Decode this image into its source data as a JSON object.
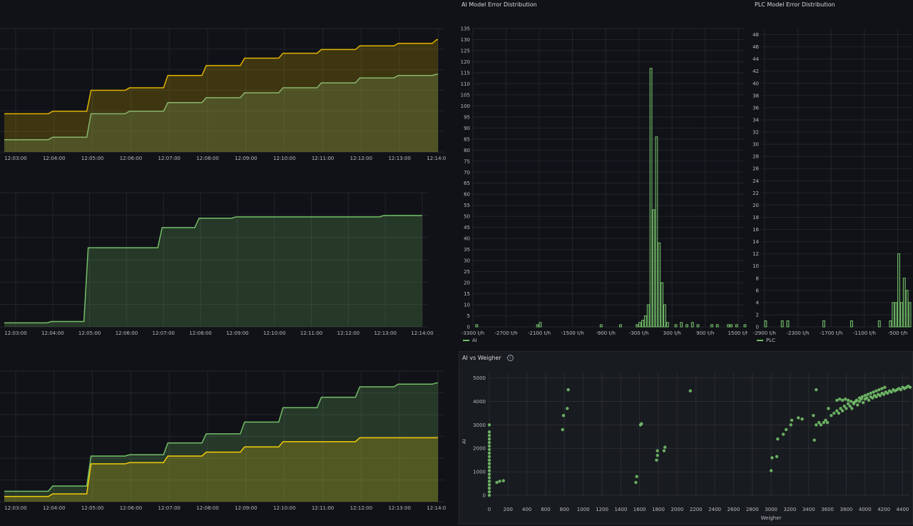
{
  "panels": {
    "left_top": {
      "time_ticks": [
        "12:03:00",
        "12:04:00",
        "12:05:00",
        "12:06:00",
        "12:07:00",
        "12:08:00",
        "12:09:00",
        "12:10:00",
        "12:11:00",
        "12:12:00",
        "12:13:00",
        "12:14:00"
      ],
      "series_colors": [
        "#e0b400",
        "#8ab66b"
      ]
    },
    "left_mid": {
      "time_ticks": [
        "12:03:00",
        "12:04:00",
        "12:05:00",
        "12:06:00",
        "12:07:00",
        "12:08:00",
        "12:09:00",
        "12:10:00",
        "12:11:00",
        "12:12:00",
        "12:13:00",
        "12:14:00"
      ],
      "series_colors": [
        "#73bf69"
      ]
    },
    "left_bottom": {
      "time_ticks": [
        "12:03:00",
        "12:04:00",
        "12:05:00",
        "12:06:00",
        "12:07:00",
        "12:08:00",
        "12:09:00",
        "12:10:00",
        "12:11:00",
        "12:12:00",
        "12:13:00",
        "12:14:00"
      ],
      "series_colors": [
        "#73bf69",
        "#f2cc0c"
      ]
    },
    "ai_hist": {
      "title": "AI Model Error Distribution",
      "legend": "AI",
      "color": "#73bf69"
    },
    "plc_hist": {
      "title": "PLC Model Error Distribution",
      "legend": "PLC",
      "color": "#73bf69"
    },
    "scatter": {
      "title": "AI vs Weigher",
      "xlabel": "Weigher",
      "ylabel": "AI",
      "color": "#73bf69"
    }
  },
  "chart_data": [
    {
      "type": "area",
      "x": [
        "12:03:00",
        "12:04:00",
        "12:05:00",
        "12:06:00",
        "12:07:00",
        "12:08:00",
        "12:09:00",
        "12:10:00",
        "12:11:00",
        "12:12:00",
        "12:13:00",
        "12:14:00"
      ],
      "series": [
        {
          "values": [
            0.31,
            0.33,
            0.5,
            0.52,
            0.62,
            0.7,
            0.76,
            0.8,
            0.83,
            0.86,
            0.88,
            0.91
          ]
        },
        {
          "values": [
            0.1,
            0.12,
            0.31,
            0.33,
            0.4,
            0.44,
            0.48,
            0.52,
            0.56,
            0.6,
            0.62,
            0.63
          ]
        }
      ],
      "xlabel": "",
      "ylabel": ""
    },
    {
      "type": "area",
      "x": [
        "12:03:00",
        "12:04:00",
        "12:05:00",
        "12:06:00",
        "12:07:00",
        "12:08:00",
        "12:09:00",
        "12:10:00",
        "12:11:00",
        "12:12:00",
        "12:13:00",
        "12:14:00"
      ],
      "series": [
        {
          "values": [
            0.03,
            0.04,
            0.59,
            0.59,
            0.74,
            0.81,
            0.82,
            0.82,
            0.82,
            0.82,
            0.83,
            0.83
          ]
        }
      ],
      "xlabel": "",
      "ylabel": ""
    },
    {
      "type": "area",
      "x": [
        "12:03:00",
        "12:04:00",
        "12:05:00",
        "12:06:00",
        "12:07:00",
        "12:08:00",
        "12:09:00",
        "12:10:00",
        "12:11:00",
        "12:12:00",
        "12:13:00",
        "12:14:00"
      ],
      "series": [
        {
          "values": [
            0.08,
            0.12,
            0.35,
            0.36,
            0.45,
            0.52,
            0.61,
            0.72,
            0.8,
            0.88,
            0.9,
            0.91
          ]
        },
        {
          "values": [
            0.04,
            0.06,
            0.29,
            0.3,
            0.35,
            0.38,
            0.42,
            0.46,
            0.46,
            0.49,
            0.49,
            0.49
          ]
        }
      ],
      "xlabel": "",
      "ylabel": ""
    },
    {
      "type": "bar",
      "title": "AI Model Error Distribution",
      "legend": [
        "AI"
      ],
      "x_ticks": [
        "-3300 t/h",
        "-2700 t/h",
        "-2100 t/h",
        "-1500 t/h",
        "-900 t/h",
        "-300 t/h",
        "300 t/h",
        "900 t/h",
        "1500 t/h"
      ],
      "x_tick_values": [
        -3300,
        -2700,
        -2100,
        -1500,
        -900,
        -300,
        300,
        900,
        1500
      ],
      "y_ticks": [
        0,
        5,
        10,
        15,
        20,
        25,
        30,
        35,
        40,
        45,
        50,
        55,
        60,
        65,
        70,
        75,
        80,
        85,
        90,
        95,
        100,
        105,
        110,
        115,
        120,
        125,
        130,
        135
      ],
      "xlim": [
        -3300,
        1600
      ],
      "ylim": [
        0,
        135
      ],
      "bin_width": 50,
      "bins": [
        {
          "x": -3250,
          "y": 1
        },
        {
          "x": -2150,
          "y": 1
        },
        {
          "x": -2100,
          "y": 2
        },
        {
          "x": -1000,
          "y": 1
        },
        {
          "x": -650,
          "y": 1
        },
        {
          "x": -350,
          "y": 1
        },
        {
          "x": -300,
          "y": 2
        },
        {
          "x": -250,
          "y": 3
        },
        {
          "x": -200,
          "y": 5
        },
        {
          "x": -150,
          "y": 10
        },
        {
          "x": -100,
          "y": 117
        },
        {
          "x": -50,
          "y": 53
        },
        {
          "x": 0,
          "y": 86
        },
        {
          "x": 50,
          "y": 38
        },
        {
          "x": 100,
          "y": 20
        },
        {
          "x": 150,
          "y": 10
        },
        {
          "x": 200,
          "y": 2
        },
        {
          "x": 350,
          "y": 1
        },
        {
          "x": 450,
          "y": 2
        },
        {
          "x": 550,
          "y": 1
        },
        {
          "x": 650,
          "y": 2
        },
        {
          "x": 750,
          "y": 1
        },
        {
          "x": 1000,
          "y": 1
        },
        {
          "x": 1100,
          "y": 1
        },
        {
          "x": 1300,
          "y": 1
        },
        {
          "x": 1350,
          "y": 1
        },
        {
          "x": 1450,
          "y": 1
        },
        {
          "x": 1600,
          "y": 1
        }
      ]
    },
    {
      "type": "bar",
      "title": "PLC Model Error Distribution",
      "legend": [
        "PLC"
      ],
      "x_ticks": [
        "-2900 t/h",
        "-2300 t/h",
        "-1700 t/h",
        "-1100 t/h",
        "-500 t/h"
      ],
      "x_tick_values": [
        -2900,
        -2300,
        -1700,
        -1100,
        -500
      ],
      "y_ticks": [
        0,
        2,
        4,
        6,
        8,
        10,
        12,
        14,
        16,
        18,
        20,
        22,
        24,
        26,
        28,
        30,
        32,
        34,
        36,
        38,
        40,
        42,
        44,
        46,
        48
      ],
      "xlim": [
        -2950,
        -250
      ],
      "ylim": [
        0,
        49
      ],
      "bin_width": 50,
      "bins": [
        {
          "x": -2900,
          "y": 1
        },
        {
          "x": -2600,
          "y": 1
        },
        {
          "x": -2500,
          "y": 1
        },
        {
          "x": -1850,
          "y": 1
        },
        {
          "x": -1350,
          "y": 1
        },
        {
          "x": -850,
          "y": 1
        },
        {
          "x": -650,
          "y": 1
        },
        {
          "x": -600,
          "y": 4
        },
        {
          "x": -550,
          "y": 4
        },
        {
          "x": -500,
          "y": 12
        },
        {
          "x": -450,
          "y": 4
        },
        {
          "x": -400,
          "y": 8
        },
        {
          "x": -350,
          "y": 6
        },
        {
          "x": -300,
          "y": 4
        }
      ]
    },
    {
      "type": "scatter",
      "title": "AI vs Weigher",
      "xlabel": "Weigher",
      "ylabel": "AI",
      "x_ticks": [
        0,
        200,
        400,
        600,
        800,
        1000,
        1200,
        1400,
        1600,
        1800,
        2000,
        2200,
        2400,
        2600,
        2800,
        3000,
        3200,
        3400,
        3600,
        3800,
        4000,
        4200,
        4400
      ],
      "y_ticks": [
        0,
        1000,
        2000,
        3000,
        4000,
        5000
      ],
      "xlim": [
        0,
        4480
      ],
      "ylim": [
        0,
        5200
      ],
      "points": [
        [
          0,
          0
        ],
        [
          0,
          150
        ],
        [
          0,
          300
        ],
        [
          0,
          450
        ],
        [
          0,
          600
        ],
        [
          0,
          750
        ],
        [
          0,
          900
        ],
        [
          0,
          1050
        ],
        [
          0,
          1200
        ],
        [
          0,
          1350
        ],
        [
          0,
          1500
        ],
        [
          0,
          1650
        ],
        [
          0,
          1800
        ],
        [
          0,
          1950
        ],
        [
          0,
          2100
        ],
        [
          0,
          2250
        ],
        [
          0,
          2400
        ],
        [
          0,
          2550
        ],
        [
          0,
          2700
        ],
        [
          0,
          3000
        ],
        [
          80,
          550
        ],
        [
          110,
          600
        ],
        [
          150,
          620
        ],
        [
          780,
          2800
        ],
        [
          790,
          3400
        ],
        [
          830,
          3700
        ],
        [
          840,
          4500
        ],
        [
          1560,
          550
        ],
        [
          1570,
          800
        ],
        [
          1610,
          3000
        ],
        [
          1620,
          3050
        ],
        [
          1780,
          1500
        ],
        [
          1790,
          1700
        ],
        [
          1790,
          1900
        ],
        [
          1860,
          1900
        ],
        [
          1870,
          2050
        ],
        [
          2140,
          4450
        ],
        [
          3000,
          1050
        ],
        [
          3010,
          1600
        ],
        [
          3060,
          1650
        ],
        [
          3070,
          2400
        ],
        [
          3130,
          2600
        ],
        [
          3160,
          2800
        ],
        [
          3210,
          3000
        ],
        [
          3220,
          3200
        ],
        [
          3290,
          3300
        ],
        [
          3330,
          3250
        ],
        [
          3450,
          3400
        ],
        [
          3460,
          2350
        ],
        [
          3480,
          4500
        ],
        [
          3480,
          3000
        ],
        [
          3510,
          3100
        ],
        [
          3530,
          3000
        ],
        [
          3560,
          3100
        ],
        [
          3580,
          3200
        ],
        [
          3600,
          3100
        ],
        [
          3610,
          3700
        ],
        [
          3640,
          3400
        ],
        [
          3670,
          3500
        ],
        [
          3700,
          3600
        ],
        [
          3720,
          3500
        ],
        [
          3740,
          3700
        ],
        [
          3760,
          3600
        ],
        [
          3780,
          3800
        ],
        [
          3800,
          3700
        ],
        [
          3820,
          3900
        ],
        [
          3840,
          3800
        ],
        [
          3860,
          3700
        ],
        [
          3880,
          3900
        ],
        [
          3900,
          4000
        ],
        [
          3920,
          3850
        ],
        [
          3940,
          4000
        ],
        [
          3960,
          4100
        ],
        [
          3980,
          3950
        ],
        [
          4000,
          4100
        ],
        [
          4020,
          4150
        ],
        [
          4040,
          4050
        ],
        [
          4060,
          4200
        ],
        [
          4080,
          4150
        ],
        [
          4100,
          4250
        ],
        [
          4120,
          4200
        ],
        [
          4140,
          4300
        ],
        [
          4160,
          4250
        ],
        [
          4180,
          4350
        ],
        [
          4200,
          4300
        ],
        [
          4220,
          4400
        ],
        [
          4240,
          4350
        ],
        [
          4260,
          4450
        ],
        [
          4280,
          4400
        ],
        [
          4300,
          4500
        ],
        [
          4320,
          4450
        ],
        [
          4340,
          4500
        ],
        [
          4360,
          4550
        ],
        [
          4380,
          4500
        ],
        [
          4400,
          4600
        ],
        [
          4420,
          4550
        ],
        [
          4440,
          4600
        ],
        [
          4460,
          4650
        ],
        [
          4480,
          4600
        ],
        [
          3700,
          4050
        ],
        [
          3730,
          4100
        ],
        [
          3760,
          4050
        ],
        [
          3790,
          4100
        ],
        [
          3820,
          4050
        ],
        [
          3850,
          4000
        ],
        [
          3880,
          3950
        ],
        [
          3910,
          4050
        ],
        [
          3940,
          4150
        ],
        [
          3970,
          4200
        ],
        [
          4000,
          4250
        ],
        [
          4030,
          4300
        ],
        [
          4060,
          4350
        ],
        [
          4090,
          4400
        ],
        [
          4120,
          4450
        ],
        [
          4150,
          4500
        ],
        [
          4180,
          4550
        ],
        [
          4210,
          4600
        ]
      ]
    }
  ]
}
